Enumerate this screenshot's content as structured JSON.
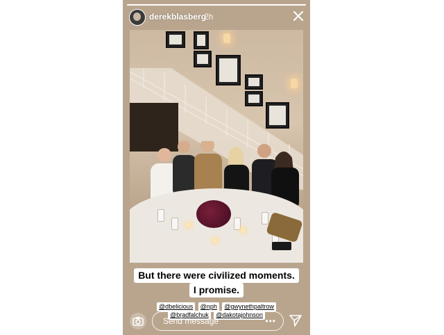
{
  "story": {
    "progress": 1.0,
    "username": "derekblasberg",
    "time_ago": "2h"
  },
  "caption": {
    "line1": "But there were civilized moments.",
    "line2": "I promise."
  },
  "mentions": {
    "row1": [
      "@dbelicious",
      "@nph",
      "@gwynethpaltrow"
    ],
    "row2": [
      "@bradfalchuk",
      "@dakotajohnson"
    ]
  },
  "footer": {
    "message_placeholder": "Send message",
    "more_label": "•••"
  },
  "icons": {
    "close": "close-icon",
    "camera": "camera-icon",
    "send": "send-icon"
  }
}
